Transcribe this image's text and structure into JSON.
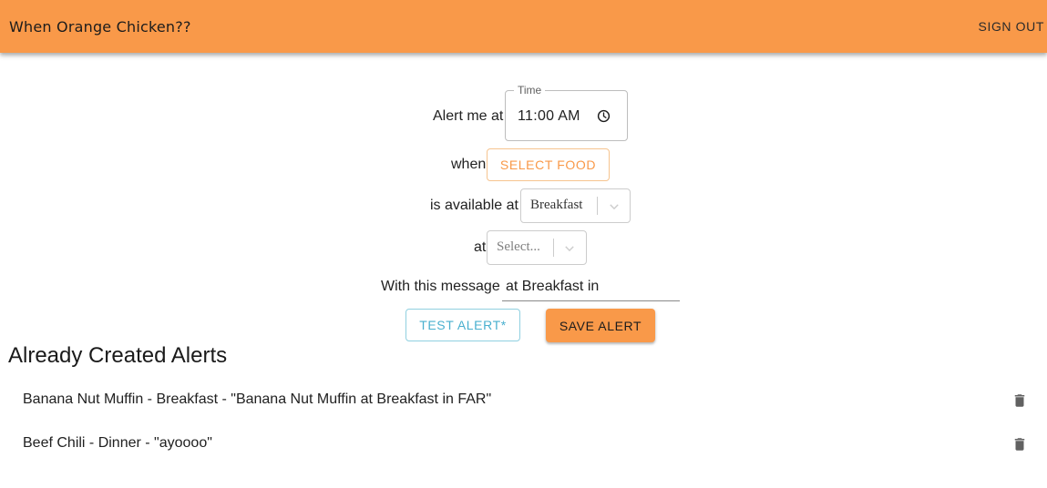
{
  "header": {
    "title": "When Orange Chicken??",
    "sign_out_label": "SIGN OUT",
    "color": "#f99949"
  },
  "form": {
    "alert_label": "Alert me at",
    "time": {
      "legend": "Time",
      "value": "11:00 AM",
      "icon": "clock-icon"
    },
    "when_label": "when",
    "select_food_label": "SELECT FOOD",
    "available_label": "is available at",
    "meal_select": {
      "value": "Breakfast"
    },
    "at_label": "at",
    "location_select": {
      "placeholder": "Select..."
    },
    "message_label": "With this message",
    "message_value": "at Breakfast in",
    "test_button_label": "TEST ALERT*",
    "save_button_label": "SAVE ALERT"
  },
  "alerts": {
    "title": "Already Created Alerts",
    "items": [
      {
        "text": "Banana Nut Muffin - Breakfast - \"Banana Nut Muffin at Breakfast in FAR\"",
        "icon": "trash-icon"
      },
      {
        "text": "Beef Chili - Dinner - \"ayoooo\"",
        "icon": "trash-icon"
      }
    ]
  }
}
